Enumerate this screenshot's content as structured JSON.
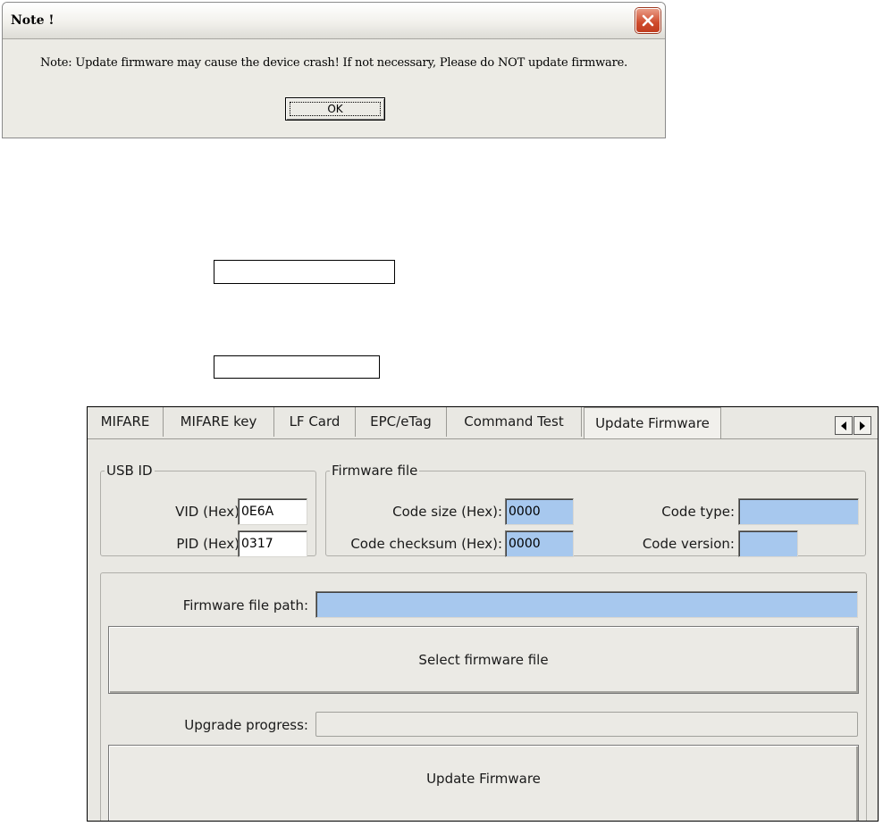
{
  "note_dialog": {
    "title": "Note !",
    "message": "Note: Update firmware may cause the device crash! If not necessary, Please do NOT update firmware.",
    "ok_label": "OK"
  },
  "tabs": [
    {
      "label": "MIFARE",
      "active": false
    },
    {
      "label": "MIFARE key",
      "active": false
    },
    {
      "label": "LF Card",
      "active": false
    },
    {
      "label": "EPC/eTag",
      "active": false
    },
    {
      "label": "Command Test",
      "active": false
    },
    {
      "label": "Update Firmware",
      "active": true
    }
  ],
  "usb_id": {
    "legend": "USB ID",
    "vid_label": "VID (Hex):",
    "vid_value": "0E6A",
    "pid_label": "PID (Hex):",
    "pid_value": "0317"
  },
  "firmware_file": {
    "legend": "Firmware file",
    "code_size_label": "Code size (Hex):",
    "code_size_value": "0000",
    "code_checksum_label": "Code checksum (Hex):",
    "code_checksum_value": "0000",
    "code_type_label": "Code type:",
    "code_type_value": "",
    "code_version_label": "Code version:",
    "code_version_value": ""
  },
  "update": {
    "path_label": "Firmware file path:",
    "path_value": "",
    "select_button_label": "Select firmware file",
    "progress_label": "Upgrade progress:",
    "progress_percent": 0,
    "update_button_label": "Update Firmware"
  },
  "colors": {
    "readonly_field": "#a7c8ee",
    "panel_background": "#e9e8e3",
    "close_button": "#cf4a2b"
  }
}
